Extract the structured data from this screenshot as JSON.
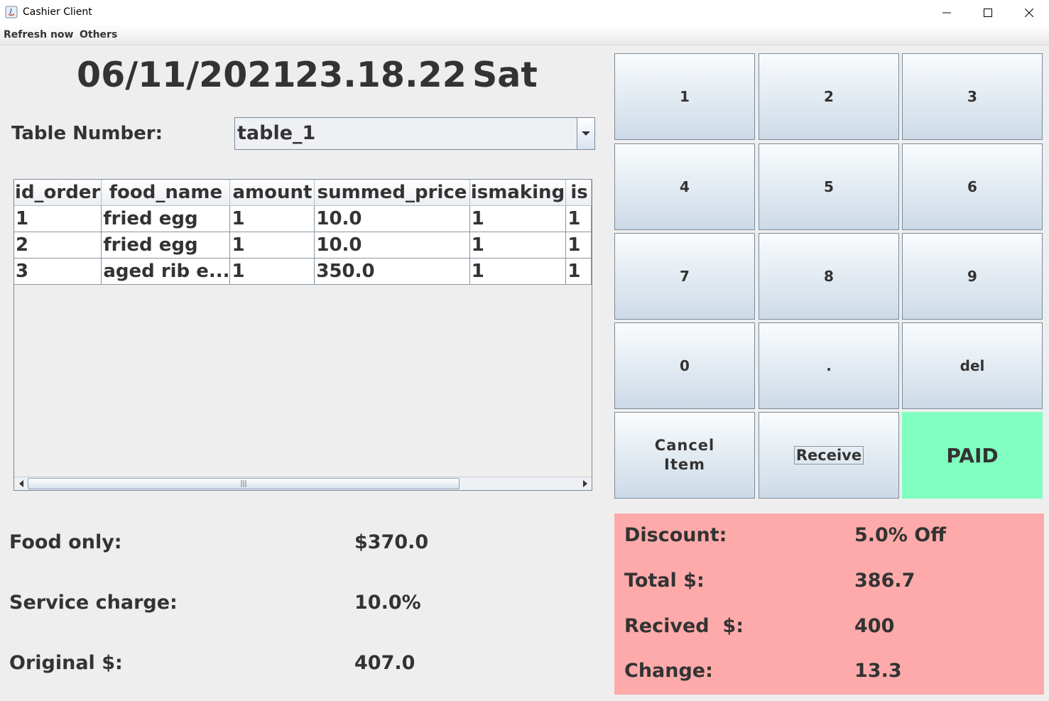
{
  "window": {
    "title": "Cashier Client"
  },
  "menu": {
    "refresh": "Refresh now",
    "others": "Others"
  },
  "clock": {
    "date": "06/11/2021",
    "time": "23.18.22",
    "day": "Sat"
  },
  "table_select": {
    "label": "Table Number:",
    "value": "table_1"
  },
  "orders": {
    "columns": [
      "id_order",
      "food_name",
      "amount",
      "summed_price",
      "ismaking",
      "is"
    ],
    "rows": [
      [
        "1",
        "fried egg",
        "1",
        "10.0",
        "1",
        "1"
      ],
      [
        "2",
        "fried egg",
        "1",
        "10.0",
        "1",
        "1"
      ],
      [
        "3",
        "aged rib e...",
        "1",
        "350.0",
        "1",
        "1"
      ]
    ]
  },
  "totals": {
    "food_only_label": "Food only:",
    "food_only_value": "$370.0",
    "service_label": "Service charge:",
    "service_value": "10.0%",
    "original_label": "Original $:",
    "original_value": "407.0"
  },
  "keypad": {
    "k1": "1",
    "k2": "2",
    "k3": "3",
    "k4": "4",
    "k5": "5",
    "k6": "6",
    "k7": "7",
    "k8": "8",
    "k9": "9",
    "k0": "0",
    "dot": ".",
    "del": "del",
    "cancel_line1": "Cancel",
    "cancel_line2": "Item",
    "receive": "Receive",
    "paid": "PAID"
  },
  "payment": {
    "discount_label": "Discount:",
    "discount_value": "5.0% Off",
    "total_label": "Total $:",
    "total_value": "386.7",
    "received_label": "Recived  $:",
    "received_value": "400",
    "change_label": "Change:",
    "change_value": "13.3"
  },
  "colors": {
    "paid_bg": "#80ffc0",
    "summary_bg": "#ffaaaa"
  }
}
